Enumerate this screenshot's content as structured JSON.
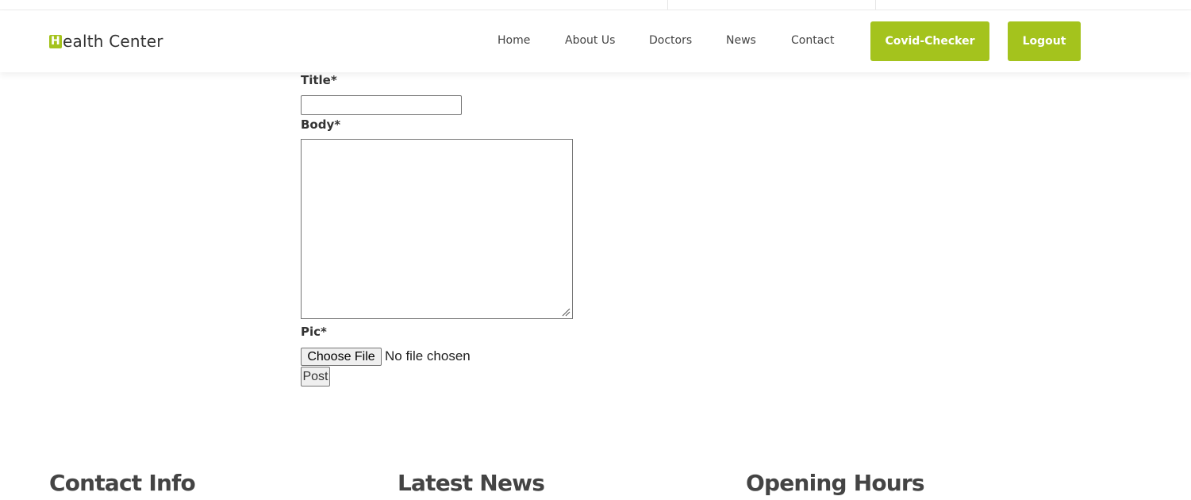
{
  "brand": {
    "logo_letter": "H",
    "logo_rest": "ealth Center",
    "accent_color": "#a4c31d"
  },
  "nav": {
    "items": [
      "Home",
      "About Us",
      "Doctors",
      "News",
      "Contact"
    ]
  },
  "header_buttons": {
    "covid_checker": "Covid-Checker",
    "logout": "Logout"
  },
  "form": {
    "title_label": "Title*",
    "title_value": "",
    "body_label": "Body*",
    "body_value": "",
    "pic_label": "Pic*",
    "choose_file_label": "Choose File",
    "file_status": "No file chosen",
    "post_label": "Post"
  },
  "footer": {
    "headings": [
      "Contact Info",
      "Latest News",
      "Opening Hours"
    ]
  }
}
